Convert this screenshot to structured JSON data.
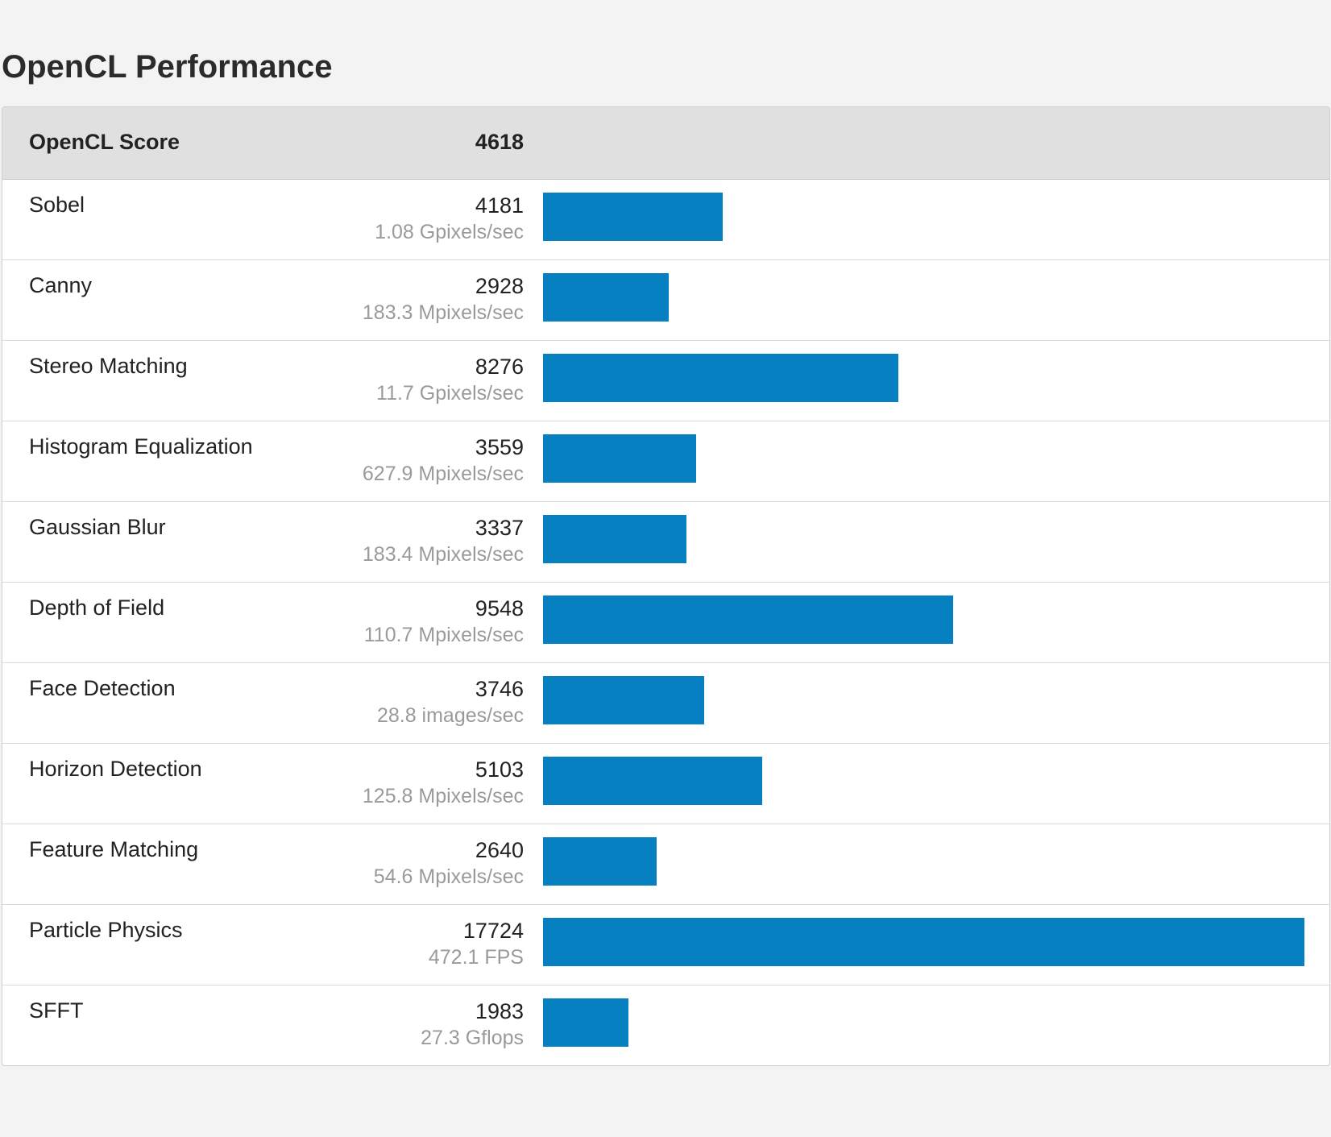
{
  "page": {
    "title": "OpenCL Performance"
  },
  "colors": {
    "bar": "#0780c1",
    "header_bg": "#e0e0e0",
    "detail_text": "#9a9a9a"
  },
  "summary": {
    "label": "OpenCL Score",
    "score": "4618"
  },
  "chart_data": {
    "type": "bar",
    "orientation": "horizontal",
    "title": "OpenCL Performance",
    "categories": [
      "Sobel",
      "Canny",
      "Stereo Matching",
      "Histogram Equalization",
      "Gaussian Blur",
      "Depth of Field",
      "Face Detection",
      "Horizon Detection",
      "Feature Matching",
      "Particle Physics",
      "SFFT"
    ],
    "values": [
      4181,
      2928,
      8276,
      3559,
      3337,
      9548,
      3746,
      5103,
      2640,
      17724,
      1983
    ],
    "xlim": [
      0,
      17724
    ],
    "grid": false,
    "rows": [
      {
        "name": "Sobel",
        "score": "4181",
        "detail": "1.08 Gpixels/sec",
        "value": 4181
      },
      {
        "name": "Canny",
        "score": "2928",
        "detail": "183.3 Mpixels/sec",
        "value": 2928
      },
      {
        "name": "Stereo Matching",
        "score": "8276",
        "detail": "11.7 Gpixels/sec",
        "value": 8276
      },
      {
        "name": "Histogram Equalization",
        "score": "3559",
        "detail": "627.9 Mpixels/sec",
        "value": 3559
      },
      {
        "name": "Gaussian Blur",
        "score": "3337",
        "detail": "183.4 Mpixels/sec",
        "value": 3337
      },
      {
        "name": "Depth of Field",
        "score": "9548",
        "detail": "110.7 Mpixels/sec",
        "value": 9548
      },
      {
        "name": "Face Detection",
        "score": "3746",
        "detail": "28.8 images/sec",
        "value": 3746
      },
      {
        "name": "Horizon Detection",
        "score": "5103",
        "detail": "125.8 Mpixels/sec",
        "value": 5103
      },
      {
        "name": "Feature Matching",
        "score": "2640",
        "detail": "54.6 Mpixels/sec",
        "value": 2640
      },
      {
        "name": "Particle Physics",
        "score": "17724",
        "detail": "472.1 FPS",
        "value": 17724
      },
      {
        "name": "SFFT",
        "score": "1983",
        "detail": "27.3 Gflops",
        "value": 1983
      }
    ]
  }
}
